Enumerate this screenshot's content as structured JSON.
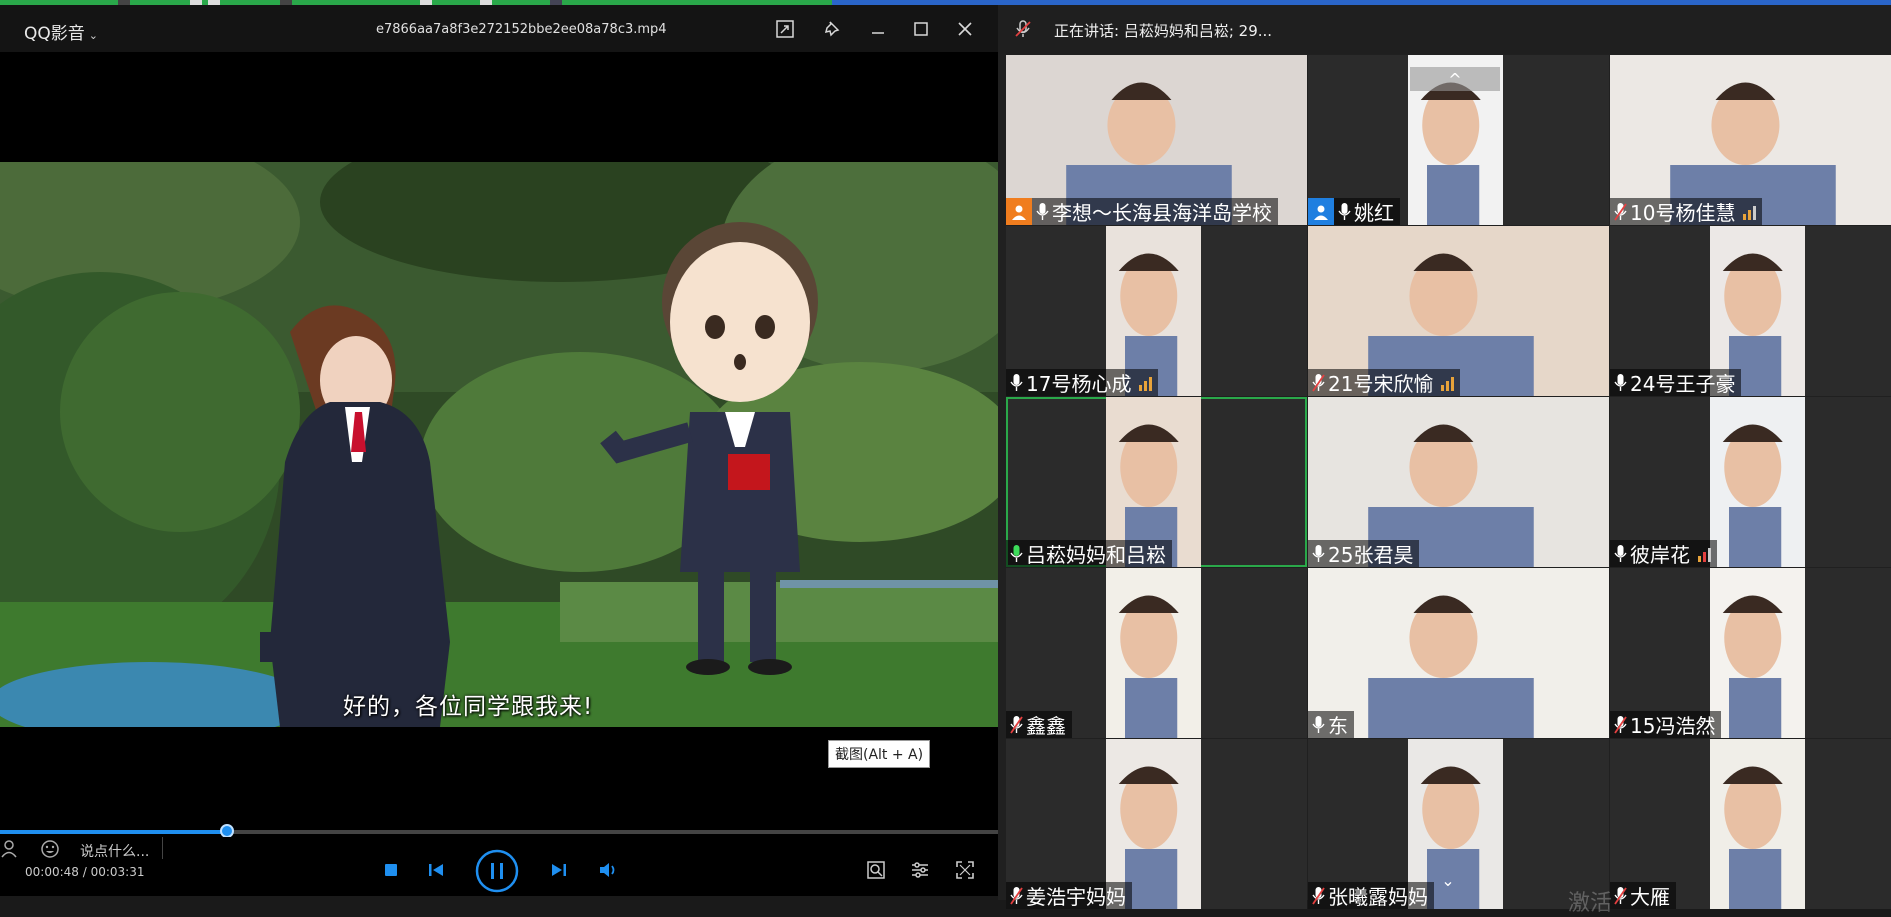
{
  "player": {
    "app_name": "QQ影音",
    "file_name": "e7866aa7a8f3e272152bbe2ee08a78c3.mp4",
    "subtitle": "好的，各位同学跟我来!",
    "screenshot_tooltip": "截图(Alt + A)",
    "danmu_placeholder": "说点什么...",
    "time": "00:00:48 / 00:03:31",
    "progress_fraction": 0.227,
    "accent_color": "#1f8ff0",
    "icons": [
      "mini-mode-icon",
      "pin-icon",
      "minimize-icon",
      "maximize-icon",
      "close-icon",
      "stop-icon",
      "prev-icon",
      "pause-icon",
      "next-icon",
      "volume-icon",
      "screenshot-icon",
      "settings-icon",
      "fullscreen-icon"
    ]
  },
  "meeting": {
    "speaking_text": "正在讲话: 吕菘妈妈和吕崧; 29...",
    "watermark": "激活",
    "tiles": [
      {
        "name": "李想～长海县海洋岛学校",
        "mic": "on",
        "badge": "host"
      },
      {
        "name": "姚红",
        "mic": "on",
        "badge": "cohost"
      },
      {
        "name": "10号杨佳慧",
        "mic": "off",
        "signal": true
      },
      {
        "name": "17号杨心成",
        "mic": "on",
        "signal": true
      },
      {
        "name": "21号宋欣愉",
        "mic": "off",
        "signal": true
      },
      {
        "name": "24号王子豪",
        "mic": "on"
      },
      {
        "name": "吕菘妈妈和吕崧",
        "mic": "speaking",
        "active": true
      },
      {
        "name": "25张君昊",
        "mic": "on"
      },
      {
        "name": "彼岸花",
        "mic": "on",
        "signal": true
      },
      {
        "name": "鑫鑫",
        "mic": "off"
      },
      {
        "name": "东",
        "mic": "on"
      },
      {
        "name": "15冯浩然",
        "mic": "off"
      },
      {
        "name": "姜浩宇妈妈",
        "mic": "off"
      },
      {
        "name": "张曦露妈妈",
        "mic": "off"
      },
      {
        "name": "大雁",
        "mic": "off"
      }
    ]
  }
}
